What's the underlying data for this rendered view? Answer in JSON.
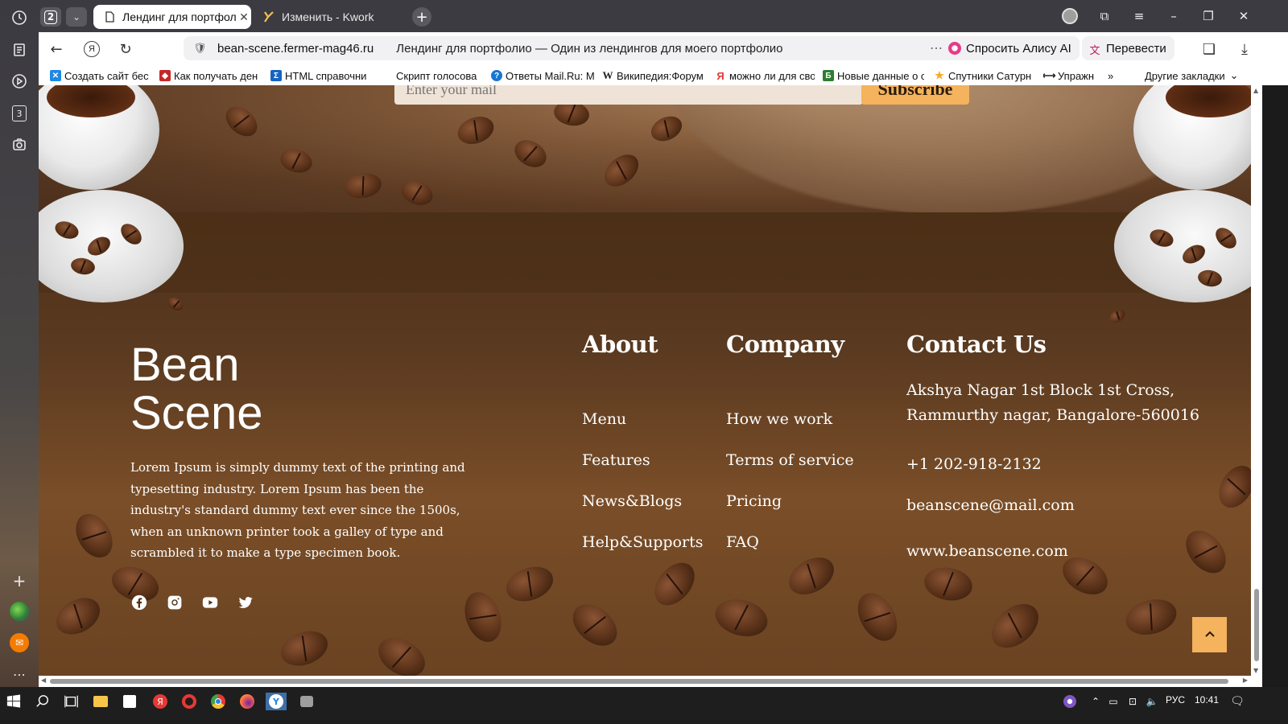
{
  "browser": {
    "tab_count": "2",
    "tabs": [
      {
        "title": "Лендинг для портфолио",
        "active": true
      },
      {
        "title": "Изменить - Kwork",
        "active": false
      }
    ],
    "sidebar_badge": "3",
    "address": {
      "host": "bean-scene.fermer-mag46.ru",
      "page_title": "Лендинг для портфолио — Один из лендингов для моего портфолио",
      "ask_alice": "Спросить Алису AI",
      "translate": "Перевести"
    },
    "bookmarks": [
      {
        "label": "Создать сайт бес",
        "icon": "x-logo-icon",
        "color": "#1e88e5"
      },
      {
        "label": "Как получать ден",
        "icon": "shield-icon",
        "color": "#c62828"
      },
      {
        "label": "HTML справочни",
        "icon": "sigma-icon",
        "color": "#1565c0"
      },
      {
        "label": "Скрипт голосова",
        "icon": "none",
        "color": "#ffffff"
      },
      {
        "label": "Ответы Mail.Ru: М",
        "icon": "question-icon",
        "color": "#1976d2"
      },
      {
        "label": "Википедия:Форум",
        "icon": "wikipedia-icon",
        "color": "#222222"
      },
      {
        "label": "можно ли для сво",
        "icon": "yandex-icon",
        "color": "#e53935"
      },
      {
        "label": "Новые данные о с",
        "icon": "b-icon",
        "color": "#2e7d32"
      },
      {
        "label": "Спутники Сатурн",
        "icon": "star-icon",
        "color": "#f9a825"
      },
      {
        "label": "Упражн",
        "icon": "arrows-icon",
        "color": "#222222"
      }
    ],
    "other_bookmarks": "Другие закладки"
  },
  "page": {
    "email_placeholder": "Enter your mail",
    "subscribe_label": "Subscribe",
    "logo_line1": "Bean",
    "logo_line2": "Scene",
    "description": "Lorem Ipsum is simply dummy text of the printing and typesetting industry. Lorem Ipsum has been the industry's standard dummy text ever since the 1500s, when an unknown printer took a galley of type and scrambled it to make a type specimen book.",
    "about": {
      "heading": "About",
      "links": [
        "Menu",
        "Features",
        "News&Blogs",
        "Help&Supports"
      ]
    },
    "company": {
      "heading": "Company",
      "links": [
        "How we work",
        "Terms of service",
        "Pricing",
        "FAQ"
      ]
    },
    "contact": {
      "heading": "Contact Us",
      "address_line1": "Akshya Nagar 1st Block 1st Cross,",
      "address_line2": "Rammurthy nagar, Bangalore-560016",
      "phone": "+1 202-918-2132",
      "email": "beanscene@mail.com",
      "website": "www.beanscene.com"
    },
    "socials": [
      "facebook-icon",
      "instagram-icon",
      "youtube-icon",
      "twitter-icon"
    ]
  },
  "taskbar": {
    "language": "РУС",
    "time": "10:41"
  },
  "colors": {
    "accent": "#f4b35c",
    "footer_bg": "#4e3118",
    "text": "#ffffff"
  }
}
